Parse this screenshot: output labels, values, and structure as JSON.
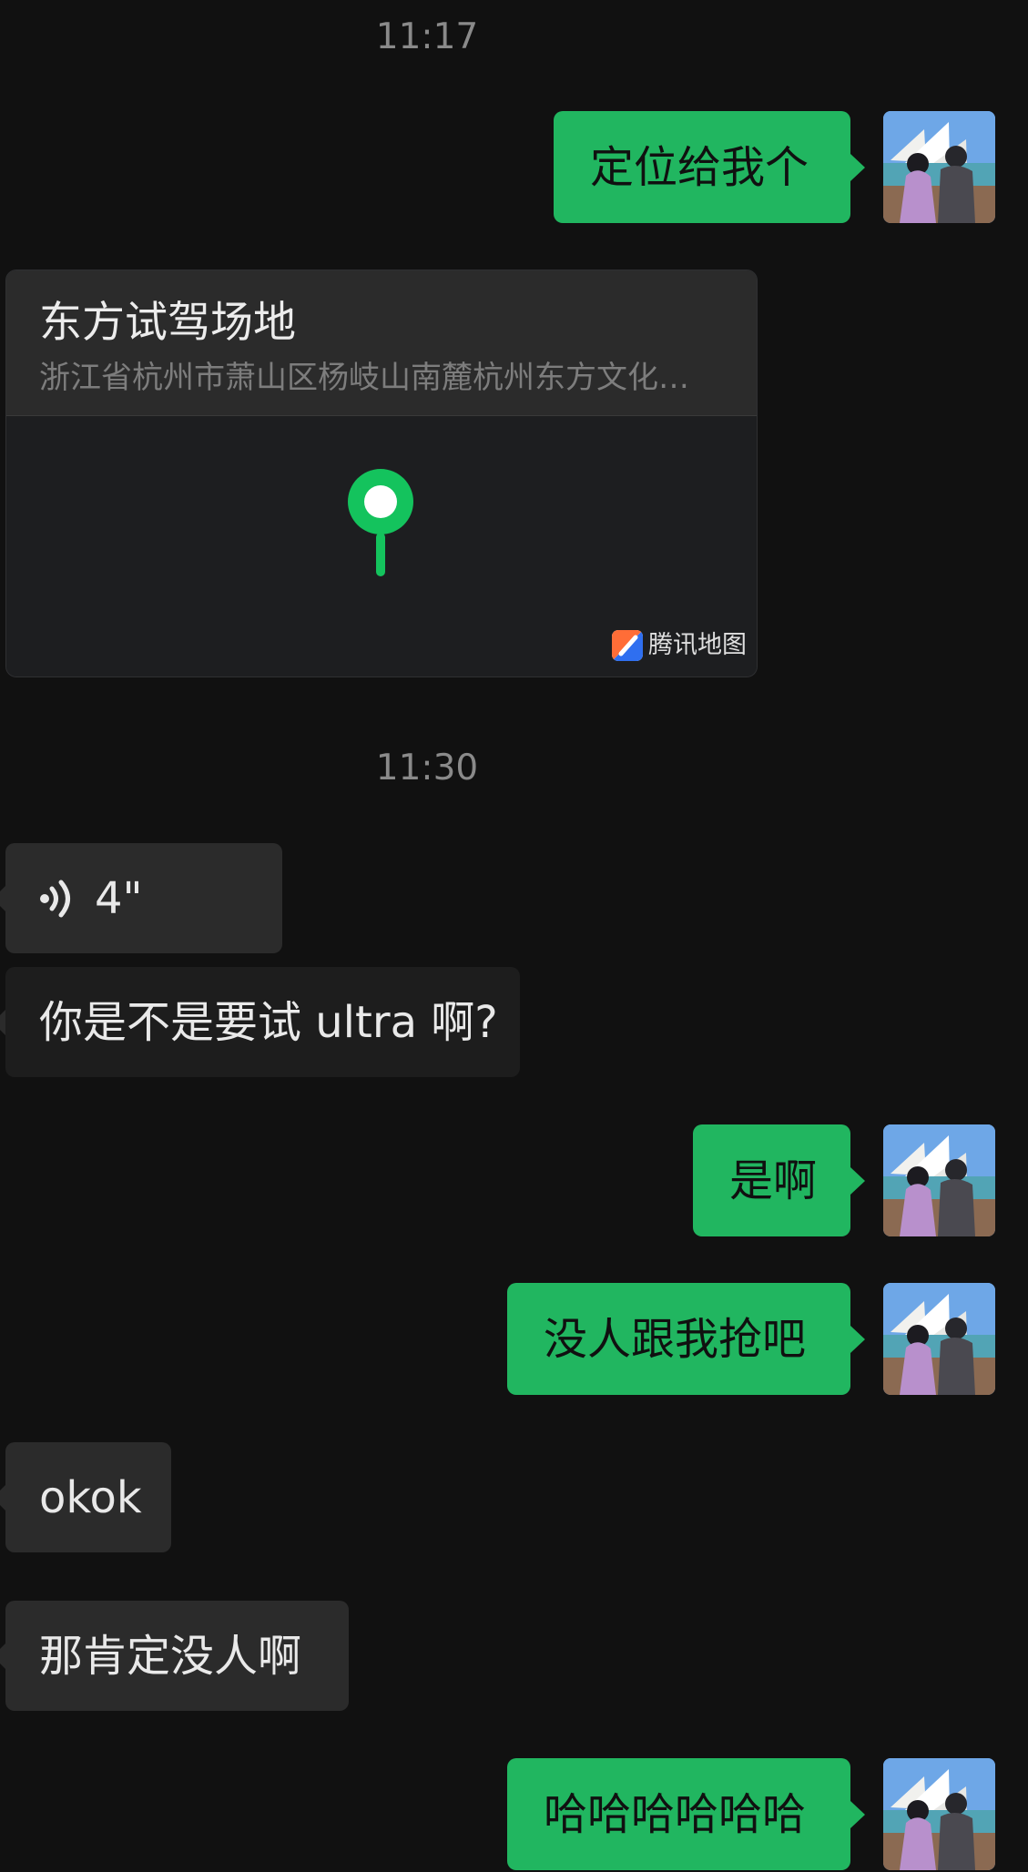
{
  "chat": {
    "time_1117": "11:17",
    "time_1130": "11:30",
    "messages": {
      "out_location_request": "定位给我个",
      "in_location": {
        "title": "东方试驾场地",
        "address": "浙江省杭州市萧山区杨岐山南麓杭州东方文化…",
        "provider": "腾讯地图"
      },
      "in_voice_duration": "4\"",
      "in_question": "你是不是要试 ultra 啊?",
      "out_yes": "是啊",
      "out_no_one": "没人跟我抢吧",
      "in_okok": "okok",
      "in_surely": "那肯定没人啊",
      "out_laugh": "哈哈哈哈哈哈"
    }
  },
  "colors": {
    "background": "#111111",
    "outgoing_bubble": "#21b660",
    "incoming_bubble": "#2b2b2b",
    "timestamp": "#8a8a8a",
    "map_pin": "#14c35d"
  },
  "icons": {
    "avatar": "couple-opera-house-avatar",
    "map_pin": "location-pin-icon",
    "voice": "voice-wave-icon",
    "map_provider": "tencent-map-logo"
  }
}
